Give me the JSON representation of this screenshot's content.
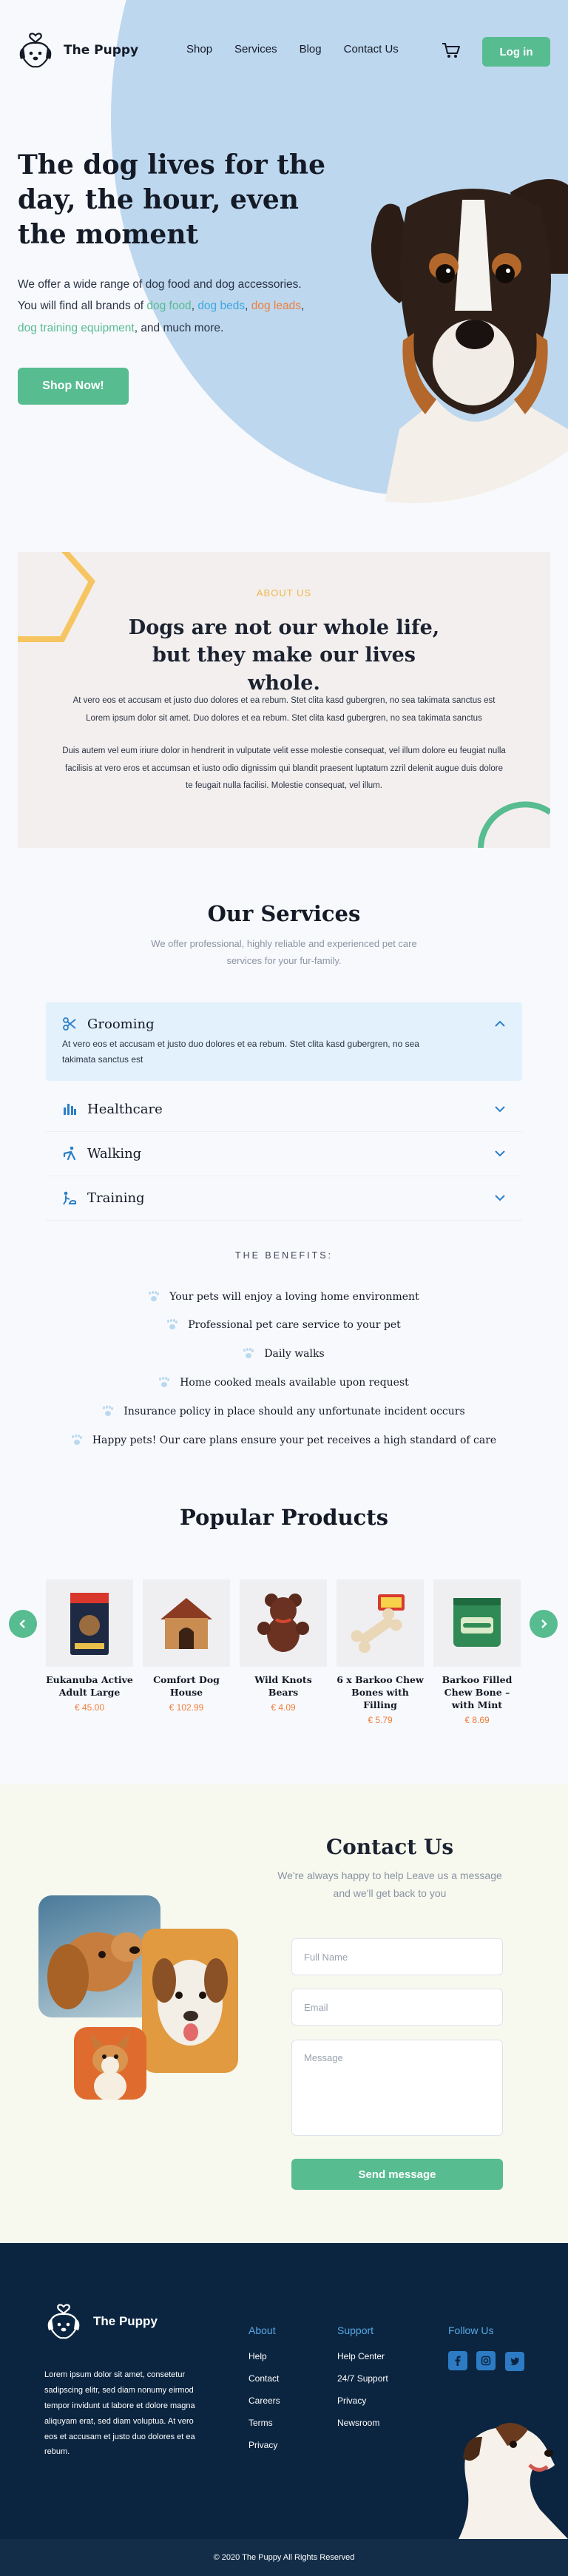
{
  "header": {
    "brand": "The Puppy",
    "nav": [
      "Shop",
      "Services",
      "Blog",
      "Contact Us"
    ],
    "login_label": "Log in"
  },
  "hero": {
    "title": "The dog lives for the day, the hour, even the moment",
    "text_intro": "We offer a wide range of dog food and dog accessories.",
    "text_2": "You will find all brands of",
    "link_food": "dog food",
    "link_beds": "dog beds",
    "link_leads": "dog leads",
    "link_training": "dog training equipment",
    "text_end": ", and much more.",
    "cta": "Shop Now!"
  },
  "about": {
    "eyebrow": "ABOUT US",
    "title": "Dogs are not our whole life, but they make our lives whole.",
    "p1": "At vero eos et accusam et justo duo dolores et ea rebum. Stet clita kasd gubergren, no sea takimata sanctus est Lorem ipsum dolor sit amet. Duo dolores et ea rebum. Stet clita kasd gubergren, no sea takimata sanctus",
    "p2": "Duis autem vel eum iriure dolor in hendrerit in vulputate velit esse molestie consequat, vel illum dolore eu feugiat nulla facilisis at vero eros et accumsan et iusto odio dignissim qui blandit praesent luptatum zzril delenit augue duis dolore te feugait nulla facilisi. Molestie consequat, vel illum."
  },
  "services": {
    "title": "Our Services",
    "subtitle": "We offer professional, highly reliable and experienced pet care services for your fur-family.",
    "items": [
      {
        "label": "Grooming",
        "body": "At vero eos et accusam et justo duo dolores et ea rebum. Stet clita kasd gubergren, no sea takimata sanctus est"
      },
      {
        "label": "Healthcare"
      },
      {
        "label": "Walking"
      },
      {
        "label": "Training"
      }
    ],
    "benefits_heading": "THE BENEFITS:",
    "benefits": [
      "Your pets will enjoy a loving home environment",
      "Professional pet care service to your pet",
      "Daily walks",
      "Home cooked meals available upon request",
      "Insurance policy in place should any unfortunate incident occurs",
      "Happy pets! Our care plans ensure your pet receives a high standard of care"
    ]
  },
  "products": {
    "title": "Popular Products",
    "items": [
      {
        "name": "Eukanuba Active Adult Large",
        "price": "€ 45.00"
      },
      {
        "name": "Comfort Dog House",
        "price": "€ 102.99"
      },
      {
        "name": "Wild Knots Bears",
        "price": "€ 4.09"
      },
      {
        "name": "6 x Barkoo Chew Bones with Filling",
        "price": "€ 5.79"
      },
      {
        "name": "Barkoo Filled Chew Bone – with Mint",
        "price": "€ 8.69"
      }
    ]
  },
  "contact": {
    "title": "Contact Us",
    "subtitle": "We're always happy to help Leave us a message and we'll get back to you",
    "name_placeholder": "Full Name",
    "email_placeholder": "Email",
    "message_placeholder": "Message",
    "send_label": "Send message"
  },
  "footer": {
    "brand": "The Puppy",
    "desc": "Lorem ipsum dolor sit amet, consetetur sadipscing elitr, sed diam nonumy eirmod tempor invidunt ut labore et dolore magna aliquyam erat, sed diam voluptua. At vero eos et accusam et justo duo dolores et ea rebum.",
    "about_h": "About",
    "about_links": [
      "Help",
      "Contact",
      "Careers",
      "Terms",
      "Privacy"
    ],
    "support_h": "Support",
    "support_links": [
      "Help Center",
      "24/7 Support",
      "Privacy",
      "Newsroom"
    ],
    "follow_h": "Follow Us",
    "copyright": "© 2020 The Puppy All Rights Reserved"
  },
  "colors": {
    "accent": "#57bc90",
    "blue": "#bdd7ee",
    "orange": "#ef7f3b",
    "navy": "#0b2540"
  },
  "icons": [
    "dog-logo-icon",
    "cart-icon",
    "scissors-icon",
    "health-icon",
    "walking-icon",
    "training-icon",
    "paw-icon",
    "chevron-icon",
    "arrow-left-icon",
    "arrow-right-icon",
    "facebook-icon",
    "instagram-icon",
    "twitter-icon"
  ]
}
